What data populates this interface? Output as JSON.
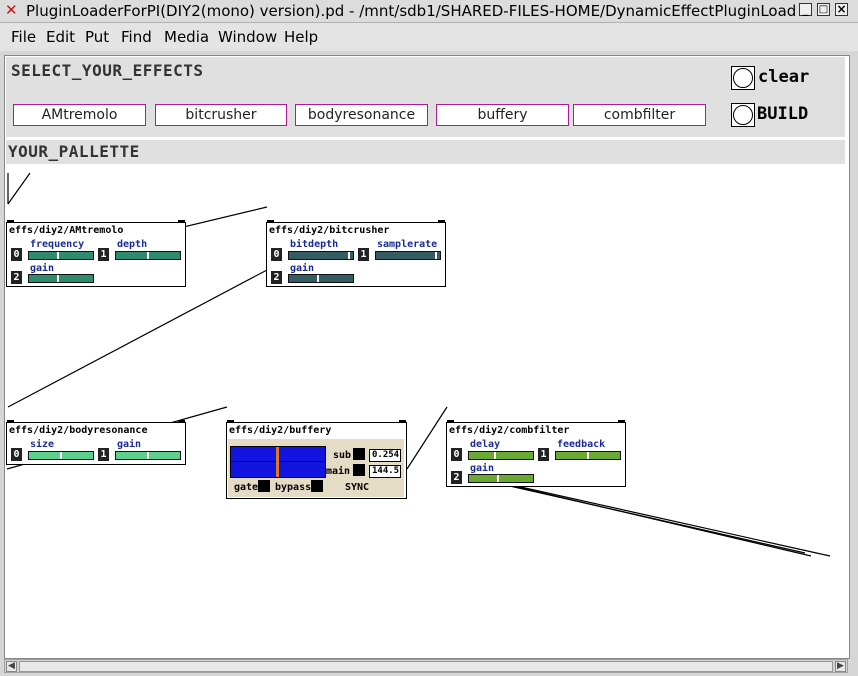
{
  "window": {
    "icon": "pd-logo-icon",
    "title": "PluginLoaderForPI(DIY2(mono) version).pd  - /mnt/sdb1/SHARED-FILES-HOME/DynamicEffectPluginLoad",
    "controls": {
      "minimize": "_",
      "maximize": "□",
      "close": "×"
    }
  },
  "menu": [
    "File",
    "Edit",
    "Put",
    "Find",
    "Media",
    "Window",
    "Help"
  ],
  "select_panel": {
    "title": "SELECT_YOUR_EFFECTS",
    "effects": [
      "AMtremolo",
      "bitcrusher",
      "bodyresonance",
      "buffery",
      "combfilter"
    ],
    "clear_label": "clear",
    "build_label": "BUILD"
  },
  "palette": {
    "title": "YOUR_PALLETTE",
    "plugins": {
      "amtremolo": {
        "title": "effs/diy2/AMtremolo",
        "params": [
          {
            "index": "0",
            "name": "frequency",
            "value": 0.45
          },
          {
            "index": "1",
            "name": "depth",
            "value": 0.5
          },
          {
            "index": "2",
            "name": "gain",
            "value": 0.45
          }
        ]
      },
      "bitcrusher": {
        "title": "effs/diy2/bitcrusher",
        "params": [
          {
            "index": "0",
            "name": "bitdepth",
            "value": 0.95
          },
          {
            "index": "1",
            "name": "samplerate",
            "value": 0.95
          },
          {
            "index": "2",
            "name": "gain",
            "value": 0.45
          }
        ]
      },
      "bodyresonance": {
        "title": "effs/diy2/bodyresonance",
        "params": [
          {
            "index": "0",
            "name": "size",
            "value": 0.5
          },
          {
            "index": "1",
            "name": "gain",
            "value": 0.5
          }
        ]
      },
      "buffery": {
        "title": "effs/diy2/buffery",
        "sub_label": "sub",
        "main_label": "main",
        "sub_value": "0.254",
        "main_value": "144.5",
        "gate_label": "gate",
        "bypass_label": "bypass",
        "sync_label": "SYNC"
      },
      "combfilter": {
        "title": "effs/diy2/combfilter",
        "params": [
          {
            "index": "0",
            "name": "delay",
            "value": 0.4
          },
          {
            "index": "1",
            "name": "feedback",
            "value": 0.5
          },
          {
            "index": "2",
            "name": "gain",
            "value": 0.45
          }
        ]
      }
    }
  },
  "colors": {
    "amtremolo_slider": "#2e8b6e",
    "bitcrusher_slider": "#355c62",
    "bodyresonance_slider": "#5ed08e",
    "combfilter_slider": "#6aaa34",
    "buffery_display": "#1414e0",
    "buffery_marker": "#e07820",
    "effect_button_border": "#b4189a"
  }
}
